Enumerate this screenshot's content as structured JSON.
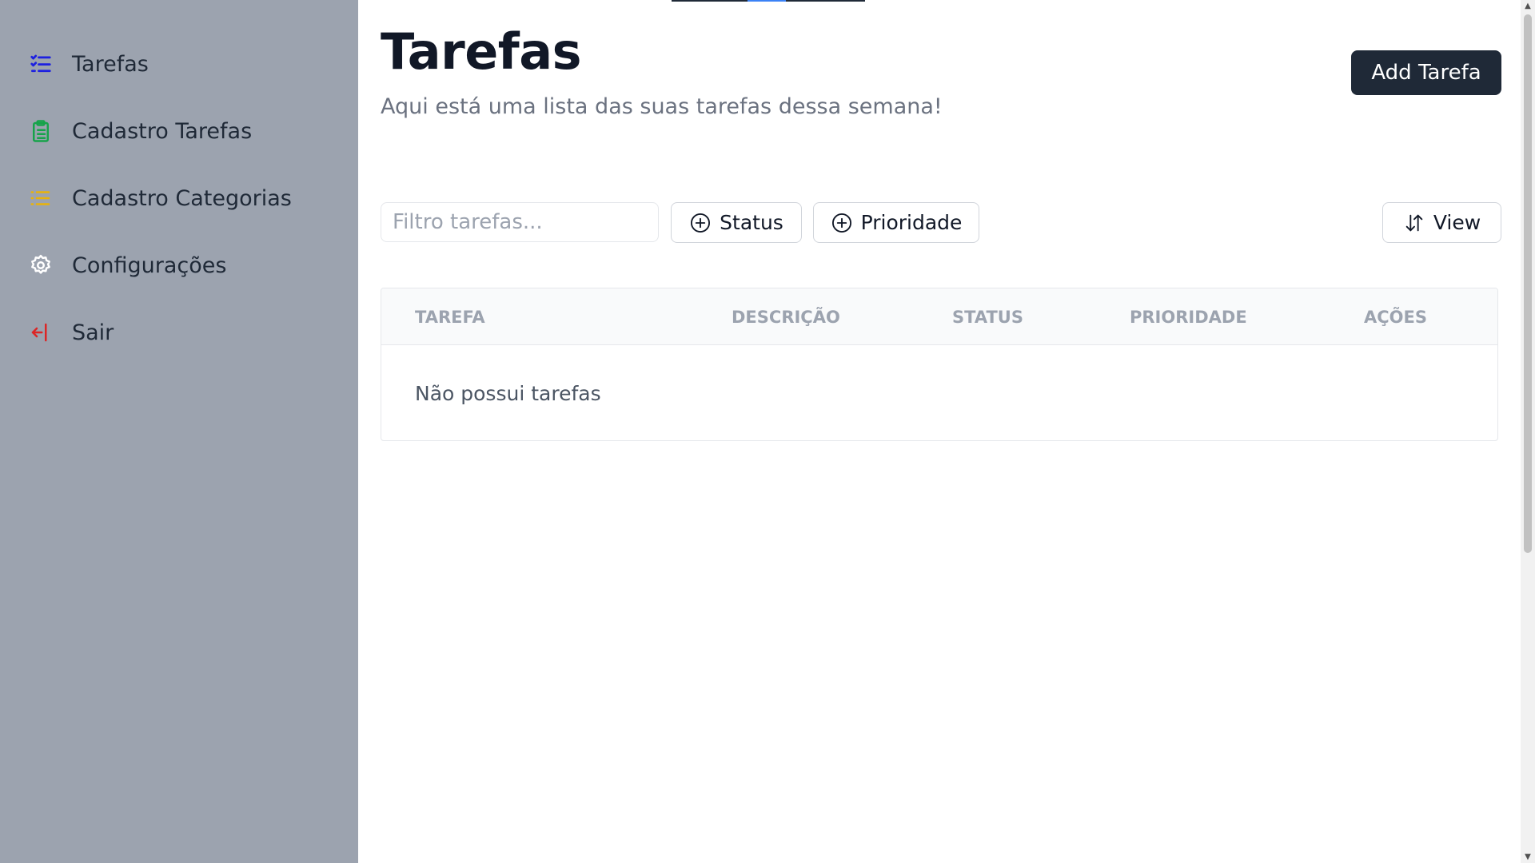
{
  "sidebar": {
    "items": [
      {
        "label": "Tarefas",
        "icon": "list-checks-icon",
        "color": "#1d20e0"
      },
      {
        "label": "Cadastro Tarefas",
        "icon": "clipboard-list-icon",
        "color": "#16a34a"
      },
      {
        "label": "Cadastro Categorias",
        "icon": "list-icon",
        "color": "#eab308"
      },
      {
        "label": "Configurações",
        "icon": "gear-icon",
        "color": "#ffffff"
      },
      {
        "label": "Sair",
        "icon": "arrow-left-to-line-icon",
        "color": "#dc2626"
      }
    ]
  },
  "header": {
    "title": "Tarefas",
    "subtitle": "Aqui está uma lista das suas tarefas dessa semana!",
    "add_button_label": "Add Tarefa"
  },
  "toolbar": {
    "filter_placeholder": "Filtro tarefas...",
    "status_label": "Status",
    "prioridade_label": "Prioridade",
    "view_label": "View"
  },
  "table": {
    "columns": [
      "TAREFA",
      "DESCRIÇÃO",
      "STATUS",
      "PRIORIDADE",
      "AÇÕES"
    ],
    "empty_message": "Não possui tarefas"
  }
}
